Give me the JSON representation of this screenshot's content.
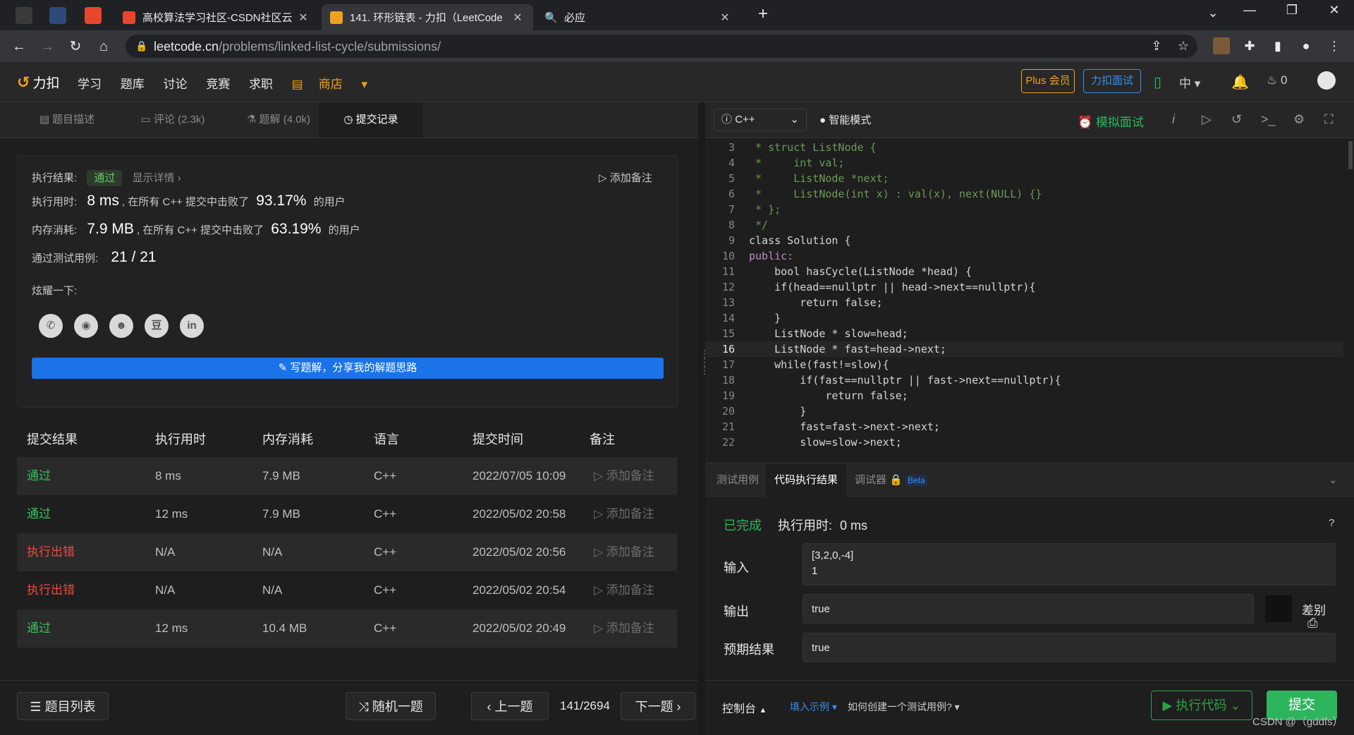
{
  "browser": {
    "tabs": [
      {
        "title": "高校算法学习社区-CSDN社区云",
        "icon_color": "#e8462c",
        "active": false
      },
      {
        "title": "141. 环形链表 - 力扣（LeetCode",
        "icon_color": "#f0a020",
        "active": true
      },
      {
        "title": "必应",
        "icon_color": "#2b6fd6",
        "active": false
      }
    ],
    "new_tab_icon": "plus-icon",
    "url_host": "leetcode.cn",
    "url_path": "/problems/linked-list-cycle/submissions/"
  },
  "lc_nav": {
    "logo": "力扣",
    "menu": [
      "学习",
      "题库",
      "讨论",
      "竞赛",
      "求职"
    ],
    "shop": "商店",
    "plus": "Plus 会员",
    "interview": "力扣面试",
    "lang": "中",
    "points": "0"
  },
  "left_tabs": {
    "description": "题目描述",
    "comments": "评论 (2.3k)",
    "solutions": "题解 (4.0k)",
    "submissions": "提交记录"
  },
  "result": {
    "label": "执行结果:",
    "status": "通过",
    "detail": "显示详情 ›",
    "add_note": "添加备注",
    "time_label": "执行用时:",
    "time_value": "8 ms",
    "time_mid": ", 在所有 C++ 提交中击败了",
    "time_pct": "93.17%",
    "users": "的用户",
    "mem_label": "内存消耗:",
    "mem_value": "7.9 MB",
    "mem_mid": ", 在所有 C++ 提交中击败了",
    "mem_pct": "63.19%",
    "cases_label": "通过测试用例:",
    "cases_value": "21 / 21",
    "share_label": "炫耀一下:",
    "write_button": "写题解，分享我的解题思路"
  },
  "submissions": {
    "headers": [
      "提交结果",
      "执行用时",
      "内存消耗",
      "语言",
      "提交时间",
      "备注"
    ],
    "rows": [
      {
        "result": "通过",
        "ok": true,
        "time": "8 ms",
        "mem": "7.9 MB",
        "lang": "C++",
        "date": "2022/07/05 10:09",
        "note": "添加备注"
      },
      {
        "result": "通过",
        "ok": true,
        "time": "12 ms",
        "mem": "7.9 MB",
        "lang": "C++",
        "date": "2022/05/02 20:58",
        "note": "添加备注"
      },
      {
        "result": "执行出错",
        "ok": false,
        "time": "N/A",
        "mem": "N/A",
        "lang": "C++",
        "date": "2022/05/02 20:56",
        "note": "添加备注"
      },
      {
        "result": "执行出错",
        "ok": false,
        "time": "N/A",
        "mem": "N/A",
        "lang": "C++",
        "date": "2022/05/02 20:54",
        "note": "添加备注"
      },
      {
        "result": "通过",
        "ok": true,
        "time": "12 ms",
        "mem": "10.4 MB",
        "lang": "C++",
        "date": "2022/05/02 20:49",
        "note": "添加备注"
      }
    ]
  },
  "left_bottom": {
    "problem_list": "题目列表",
    "random": "随机一题",
    "prev": "上一题",
    "counter": "141/2694",
    "next": "下一题"
  },
  "editor_toolbar": {
    "language": "C++",
    "smart_mode": "智能模式",
    "mock": "模拟面试"
  },
  "code": [
    {
      "n": "3",
      "t": " * struct ListNode {"
    },
    {
      "n": "4",
      "t": " *     int val;"
    },
    {
      "n": "5",
      "t": " *     ListNode *next;"
    },
    {
      "n": "6",
      "t": " *     ListNode(int x) : val(x), next(NULL) {}"
    },
    {
      "n": "7",
      "t": " * };"
    },
    {
      "n": "8",
      "t": " */"
    },
    {
      "n": "9",
      "t": "class Solution {"
    },
    {
      "n": "10",
      "t": "public:"
    },
    {
      "n": "11",
      "t": "    bool hasCycle(ListNode *head) {"
    },
    {
      "n": "12",
      "t": "    if(head==nullptr || head->next==nullptr){"
    },
    {
      "n": "13",
      "t": "        return false;"
    },
    {
      "n": "14",
      "t": "    }"
    },
    {
      "n": "15",
      "t": "    ListNode * slow=head;"
    },
    {
      "n": "16",
      "t": "    ListNode * fast=head->next;"
    },
    {
      "n": "17",
      "t": "    while(fast!=slow){"
    },
    {
      "n": "18",
      "t": "        if(fast==nullptr || fast->next==nullptr){"
    },
    {
      "n": "19",
      "t": "            return false;"
    },
    {
      "n": "20",
      "t": "        }"
    },
    {
      "n": "21",
      "t": "        fast=fast->next->next;"
    },
    {
      "n": "22",
      "t": "        slow=slow->next;"
    }
  ],
  "result_tabs": {
    "testcase": "测试用例",
    "exec_result": "代码执行结果",
    "debugger": "调试器",
    "beta": "Beta"
  },
  "exec": {
    "status": "已完成",
    "time_label": "执行用时:",
    "time_value": "0 ms",
    "input_label": "输入",
    "input_line1": "[3,2,0,-4]",
    "input_line2": "1",
    "output_label": "输出",
    "output_value": "true",
    "diff": "差别",
    "expected_label": "预期结果",
    "expected_value": "true"
  },
  "right_bottom": {
    "console": "控制台",
    "fill_example": "填入示例",
    "how_to": "如何创建一个测试用例?",
    "run": "执行代码",
    "submit": "提交"
  },
  "watermark": "CSDN @（gddfs）",
  "colors": {
    "pass": "#3dbd5c",
    "error": "#ef4743",
    "accent_blue": "#1a73e8",
    "brand_orange": "#f0a020",
    "submit_green": "#2db55d"
  }
}
